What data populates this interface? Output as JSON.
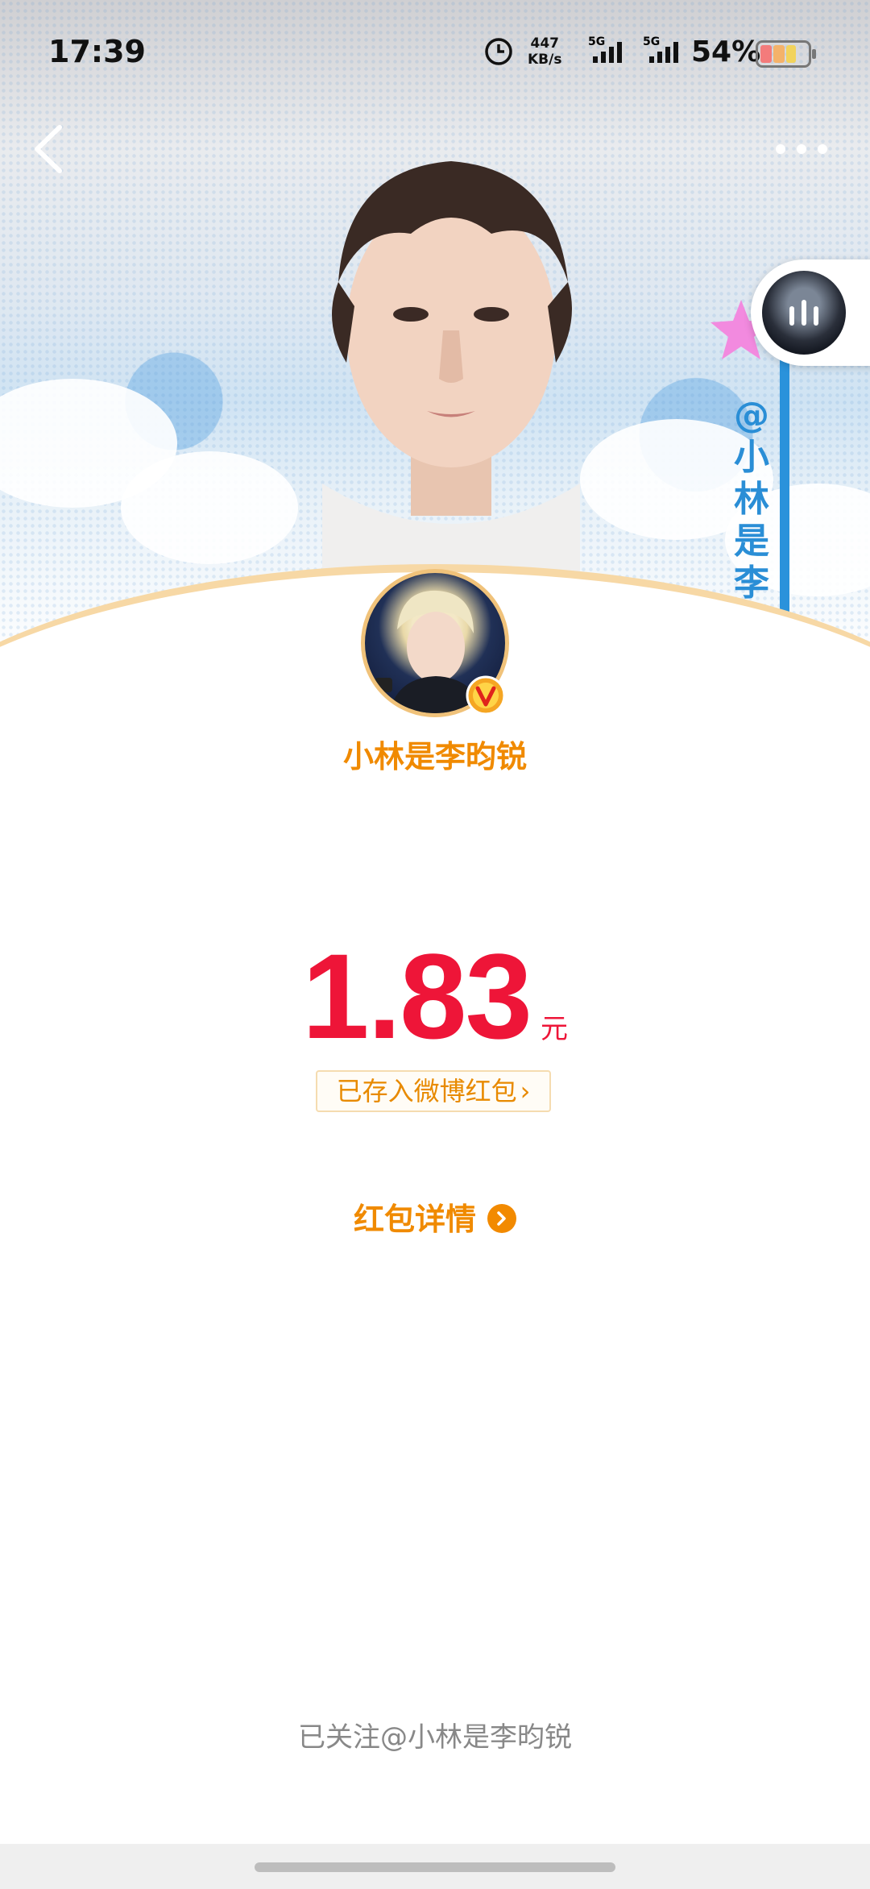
{
  "status_bar": {
    "time": "17:39",
    "net_speed_value": "447",
    "net_speed_unit": "KB/s",
    "sim1_label": "5G",
    "sim2_label": "5G",
    "battery_percent": "54%",
    "battery_level": 0.54
  },
  "banner": {
    "vertical_text": "@小林是李昀"
  },
  "profile": {
    "name": "小林是李昀锐"
  },
  "red_packet": {
    "amount": "1.83",
    "unit": "元",
    "saved_label": "已存入微博红包",
    "saved_chevron": "›",
    "details_label": "红包详情"
  },
  "footer": {
    "followed_text": "已关注@小林是李昀锐"
  },
  "colors": {
    "accent_orange": "#f08a00",
    "amount_red": "#ee1538",
    "banner_blue": "#2a8ed6"
  },
  "icons": [
    "back-arrow-icon",
    "more-dots-icon",
    "music-player-icon",
    "verified-v-icon",
    "chevron-right-icon",
    "clock-icon",
    "signal-icon",
    "battery-icon"
  ]
}
